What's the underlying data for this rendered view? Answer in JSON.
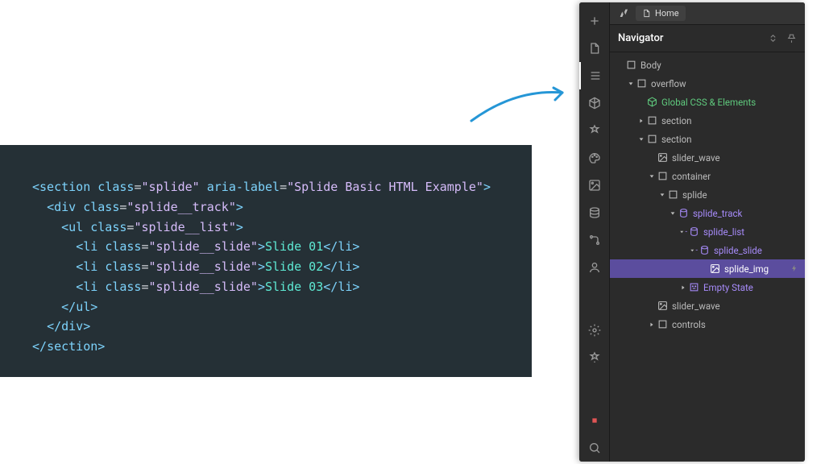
{
  "code": {
    "lines": [
      {
        "indent": 0,
        "open": true,
        "close": false,
        "tag": "section",
        "attrs": [
          [
            "class",
            "splide"
          ],
          [
            "aria-label",
            "Splide Basic HTML Example"
          ]
        ],
        "text": null
      },
      {
        "indent": 1,
        "open": true,
        "close": false,
        "tag": "div",
        "attrs": [
          [
            "class",
            "splide__track"
          ]
        ],
        "text": null
      },
      {
        "indent": 2,
        "open": true,
        "close": false,
        "tag": "ul",
        "attrs": [
          [
            "class",
            "splide__list"
          ]
        ],
        "text": null
      },
      {
        "indent": 3,
        "open": true,
        "close": true,
        "tag": "li",
        "attrs": [
          [
            "class",
            "splide__slide"
          ]
        ],
        "text": "Slide 01"
      },
      {
        "indent": 3,
        "open": true,
        "close": true,
        "tag": "li",
        "attrs": [
          [
            "class",
            "splide__slide"
          ]
        ],
        "text": "Slide 02"
      },
      {
        "indent": 3,
        "open": true,
        "close": true,
        "tag": "li",
        "attrs": [
          [
            "class",
            "splide__slide"
          ]
        ],
        "text": "Slide 03"
      },
      {
        "indent": 2,
        "open": false,
        "close": true,
        "tag": "ul",
        "attrs": [],
        "text": null
      },
      {
        "indent": 1,
        "open": false,
        "close": true,
        "tag": "div",
        "attrs": [],
        "text": null
      },
      {
        "indent": 0,
        "open": false,
        "close": true,
        "tag": "section",
        "attrs": [],
        "text": null
      }
    ]
  },
  "breadcrumb": {
    "home": "Home"
  },
  "panel": {
    "title": "Navigator"
  },
  "tree": [
    {
      "depth": 0,
      "toggle": null,
      "icon": "box",
      "label": "Body",
      "style": "normal",
      "selected": false
    },
    {
      "depth": 1,
      "toggle": "open",
      "icon": "box",
      "label": "overflow",
      "style": "normal",
      "selected": false
    },
    {
      "depth": 2,
      "toggle": null,
      "icon": "cube",
      "label": "Global CSS & Elements",
      "style": "green",
      "selected": false
    },
    {
      "depth": 2,
      "toggle": "closed",
      "icon": "box",
      "label": "section",
      "style": "normal",
      "selected": false
    },
    {
      "depth": 2,
      "toggle": "open",
      "icon": "box",
      "label": "section",
      "style": "normal",
      "selected": false
    },
    {
      "depth": 3,
      "toggle": null,
      "icon": "image",
      "label": "slider_wave",
      "style": "normal",
      "selected": false
    },
    {
      "depth": 3,
      "toggle": "open",
      "icon": "box",
      "label": "container",
      "style": "normal",
      "selected": false
    },
    {
      "depth": 4,
      "toggle": "open",
      "icon": "box",
      "label": "splide",
      "style": "normal",
      "selected": false
    },
    {
      "depth": 5,
      "toggle": "open",
      "icon": "db",
      "label": "splide_track",
      "style": "purple",
      "selected": false
    },
    {
      "depth": 6,
      "toggle": "open-dash",
      "icon": "db",
      "label": "splide_list",
      "style": "purple",
      "selected": false
    },
    {
      "depth": 7,
      "toggle": "open-dash",
      "icon": "db",
      "label": "splide_slide",
      "style": "purple",
      "selected": false
    },
    {
      "depth": 8,
      "toggle": null,
      "icon": "image",
      "label": "splide_img",
      "style": "normal",
      "selected": true,
      "extra": "bolt"
    },
    {
      "depth": 6,
      "toggle": "closed",
      "icon": "empty",
      "label": "Empty State",
      "style": "purple",
      "selected": false
    },
    {
      "depth": 3,
      "toggle": null,
      "icon": "image",
      "label": "slider_wave",
      "style": "normal",
      "selected": false
    },
    {
      "depth": 3,
      "toggle": "closed",
      "icon": "box",
      "label": "controls",
      "style": "normal",
      "selected": false
    }
  ],
  "rail": [
    "add",
    "page",
    "nav",
    "components",
    "assets",
    "palette",
    "image",
    "cms",
    "logic",
    "users",
    "spacer",
    "settings",
    "help",
    "spacer2",
    "audit",
    "search"
  ]
}
